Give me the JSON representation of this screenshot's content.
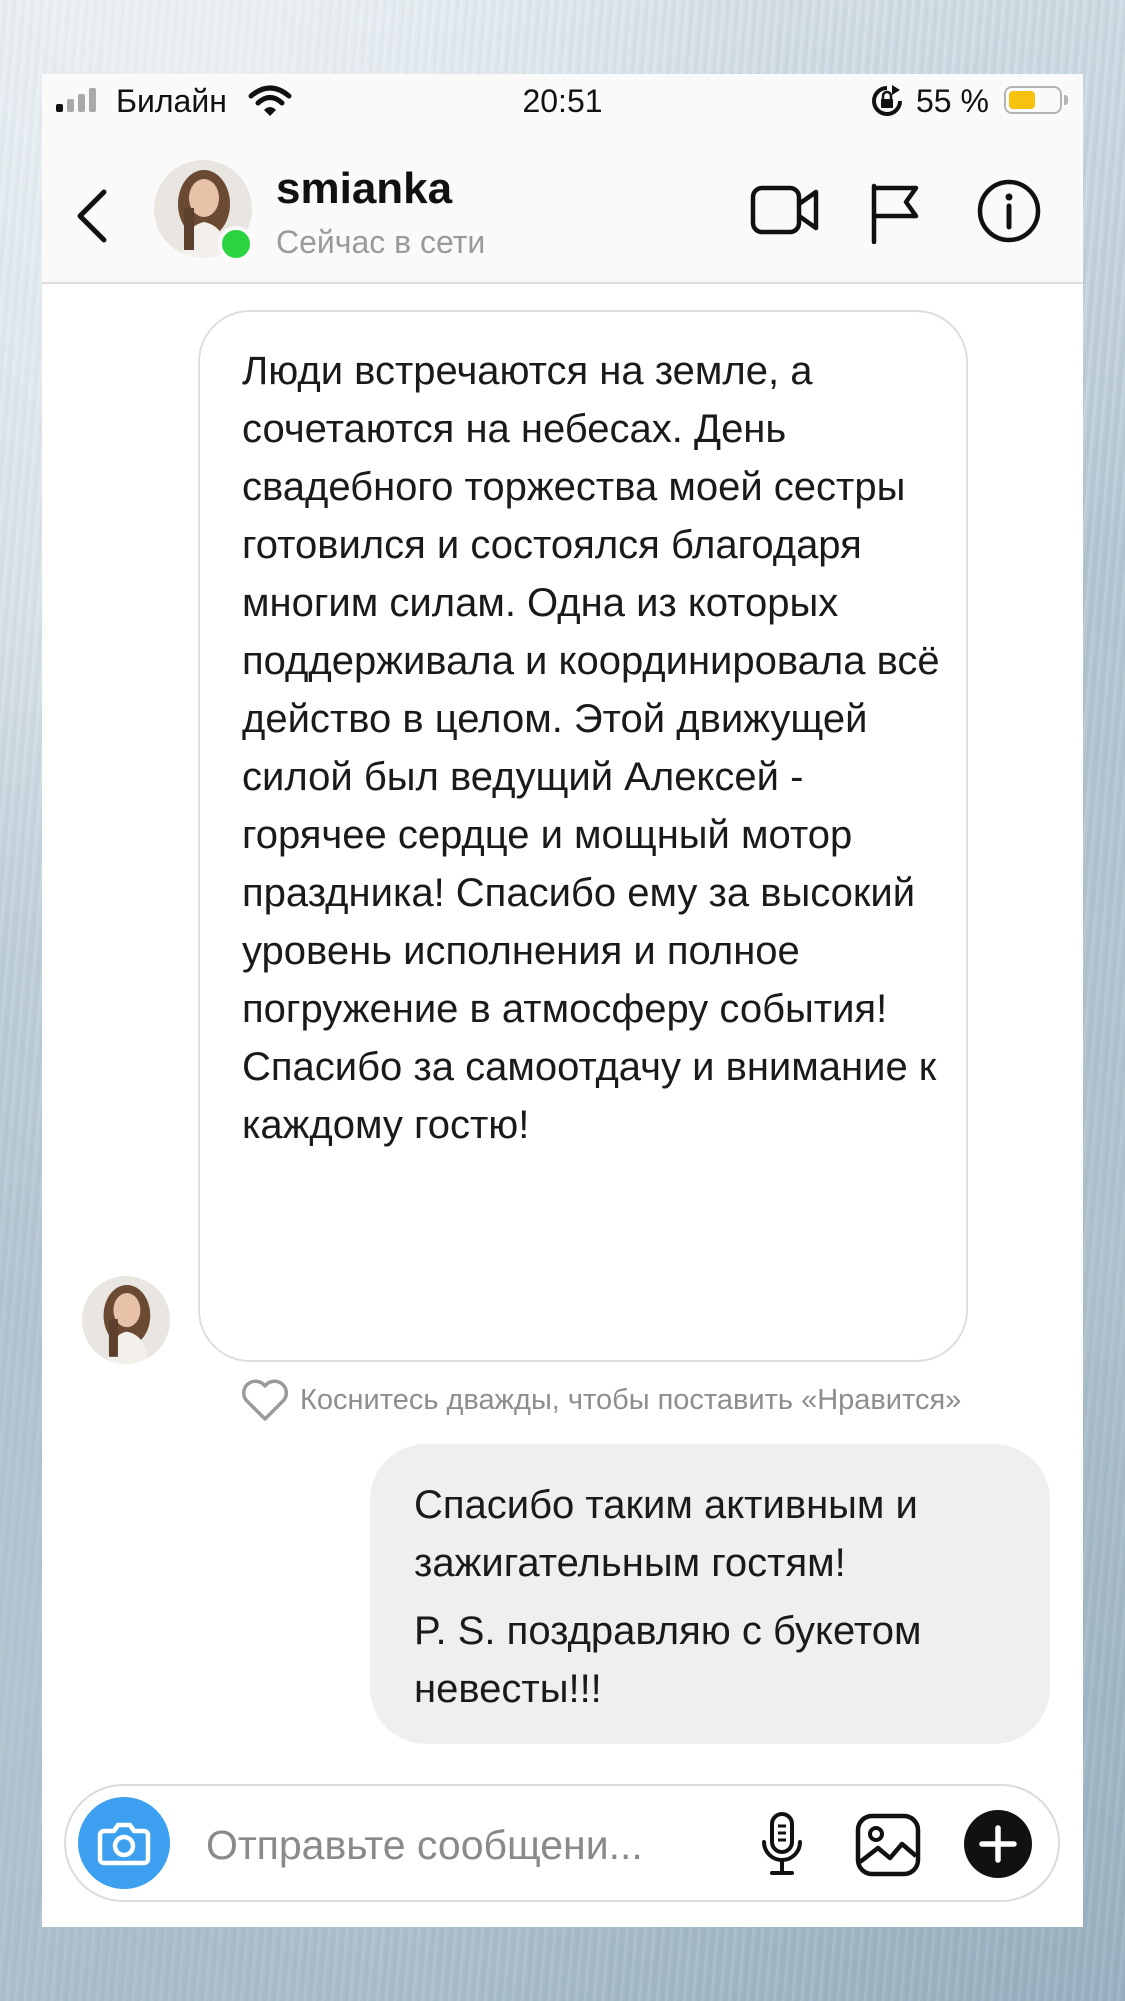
{
  "status_bar": {
    "carrier": "Билайн",
    "time": "20:51",
    "battery_percent": "55 %",
    "battery_level": 0.55,
    "signal_bars_active": 1,
    "signal_bars_total": 4
  },
  "header": {
    "username": "smianka",
    "presence": "Сейчас в сети",
    "online_color": "#2bd33f",
    "icons": [
      "back-chevron-icon",
      "video-camera-icon",
      "flag-icon",
      "info-icon"
    ]
  },
  "messages": {
    "incoming": {
      "text": "Люди встречаются на земле, а сочетаются на небесах. День свадебного торжества моей сестры готовился и состоялся благодаря многим силам. Одна из которых поддерживала и координировала всё действо в целом. Этой движущей силой был ведущий Алексей - горячее сердце и мощный мотор праздника! Спасибо ему за высокий уровень исполнения и полное погружение в атмосферу события! Спасибо за самоотдачу и внимание к каждому гостю!",
      "like_hint": "Коснитесь дважды, чтобы поставить «Нравится»"
    },
    "outgoing": {
      "line1": "Спасибо таким активным и зажигательным гостям!",
      "line2": "P. S. поздравляю с букетом невесты!!!"
    }
  },
  "composer": {
    "placeholder": "Отправьте сообщени...",
    "accent_color": "#3c9ff0",
    "icons": [
      "camera-icon",
      "microphone-icon",
      "gallery-icon",
      "plus-icon"
    ]
  }
}
